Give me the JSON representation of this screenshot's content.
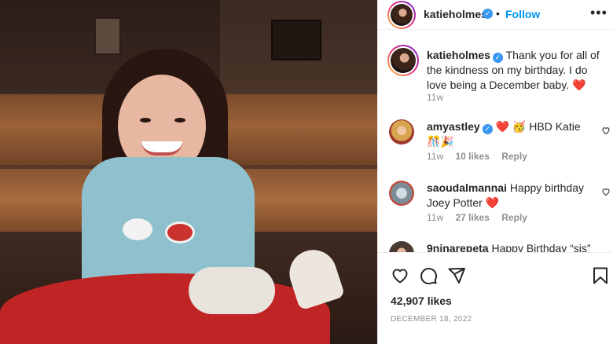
{
  "post": {
    "author": "katieholmes",
    "follow_label": "Follow",
    "separator": "•",
    "more": "•••",
    "caption": {
      "username": "katieholmes",
      "text": "Thank you for all of the kindness on my birthday. I do love being a December baby.",
      "emoji": "❤️",
      "time": "11w"
    },
    "comments": [
      {
        "username": "amyastley",
        "text": "❤️ 🥳 HBD Katie 🎊🎉",
        "time": "11w",
        "likes": "10 likes",
        "reply": "Reply"
      },
      {
        "username": "saoudalmannai",
        "text": "Happy birthday Joey Potter ❤️",
        "time": "11w",
        "likes": "27 likes",
        "reply": "Reply"
      },
      {
        "username": "9ninarepeta",
        "text": "Happy Birthday “sis” 💕"
      }
    ],
    "likes_count": "42,907 likes",
    "date": "DECEMBER 18, 2022"
  },
  "icons": [
    "verified-badge-icon",
    "heart-outline-icon",
    "comment-icon",
    "share-icon",
    "bookmark-icon",
    "more-icon"
  ],
  "colors": {
    "accent": "#0095f6",
    "verified": "#3897f0",
    "heart": "#ed4956",
    "muted": "#8e8e8e"
  }
}
